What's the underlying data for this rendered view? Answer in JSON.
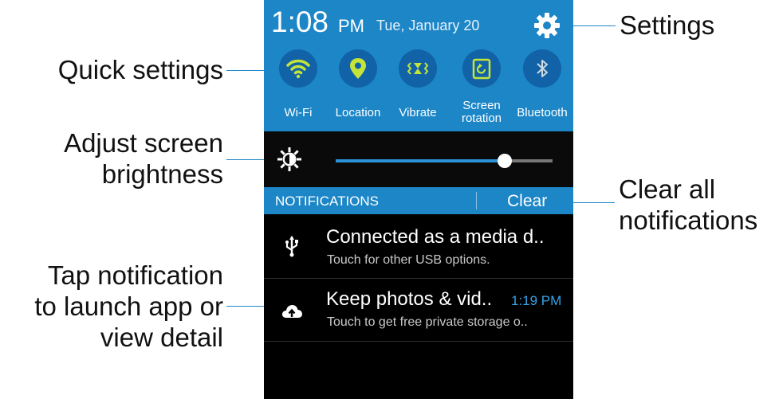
{
  "status_bar": {
    "time": "1:08",
    "ampm": "PM",
    "date": "Tue, January 20"
  },
  "quick_settings": [
    {
      "label": "Wi-Fi",
      "icon": "wifi-icon",
      "on": true
    },
    {
      "label": "Location",
      "icon": "location-icon",
      "on": true
    },
    {
      "label": "Vibrate",
      "icon": "vibrate-icon",
      "on": true
    },
    {
      "label": "Screen\nrotation",
      "icon": "screen-rotation-icon",
      "on": true
    },
    {
      "label": "Bluetooth",
      "icon": "bluetooth-icon",
      "on": false
    }
  ],
  "brightness": {
    "level": 0.78
  },
  "notifications": {
    "header": "NOTIFICATIONS",
    "clear_label": "Clear",
    "items": [
      {
        "title": "Connected as a media d..",
        "subtitle": "Touch for other USB options.",
        "time": "",
        "icon": "usb-icon"
      },
      {
        "title": "Keep photos & vid..",
        "subtitle": "Touch to get free private storage o..",
        "time": "1:19 PM",
        "icon": "cloud-upload-icon"
      }
    ]
  },
  "callouts": {
    "quick_settings": "Quick settings",
    "brightness": "Adjust screen\nbrightness",
    "notification": "Tap notification\nto launch app or\nview detail",
    "settings": "Settings",
    "clear_all": "Clear all\nnotifications"
  },
  "colors": {
    "panel": "#1c86c7",
    "icon_active": "#c5e43a",
    "icon_inactive": "#cfd8df",
    "accent_text": "#34a3e8"
  }
}
